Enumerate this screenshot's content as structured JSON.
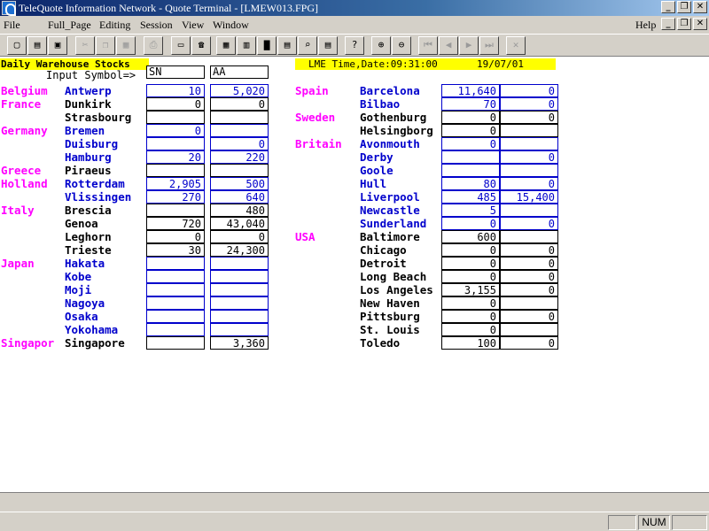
{
  "window": {
    "title": "TeleQuote Information Network - Quote Terminal - [LMEW013.FPG]",
    "buttons": [
      "_",
      "❐",
      "✕"
    ]
  },
  "menu": {
    "items": [
      "File",
      "Full_Page",
      "Editing",
      "Session",
      "View",
      "Window"
    ],
    "help": "Help",
    "mdi_buttons": [
      "_",
      "❐",
      "✕"
    ]
  },
  "toolbar": {
    "buttons": [
      "new-icon",
      "open-icon",
      "save-icon",
      "cut-icon",
      "copy-icon",
      "paste-icon",
      "print-icon",
      "keypad-icon",
      "phone-icon",
      "grid-icon",
      "chart-icon",
      "bar-chart-icon",
      "live-icon",
      "zoom-page-icon",
      "news-icon",
      "help-icon",
      "zoom-in-icon",
      "zoom-out-icon",
      "first-icon",
      "prev-icon",
      "next-icon",
      "last-icon",
      "close-icon"
    ]
  },
  "page": {
    "title": "Daily Warehouse Stocks",
    "input_label": "Input Symbol=>",
    "symbol1": "SN",
    "symbol2": "AA",
    "time_label": "LME Time,Date:09:31:00",
    "date": "19/07/01",
    "left_rows": [
      {
        "country": "Belgium",
        "city": "Antwerp",
        "blue": true,
        "v1": "10",
        "v2": "5,020"
      },
      {
        "country": "France",
        "city": "Dunkirk",
        "blue": false,
        "v1": "0",
        "v2": "0"
      },
      {
        "country": "",
        "city": "Strasbourg",
        "blue": false,
        "v1": "",
        "v2": ""
      },
      {
        "country": "Germany",
        "city": "Bremen",
        "blue": true,
        "v1": "0",
        "v2": ""
      },
      {
        "country": "",
        "city": "Duisburg",
        "blue": true,
        "v1": "",
        "v2": "0"
      },
      {
        "country": "",
        "city": "Hamburg",
        "blue": true,
        "v1": "20",
        "v2": "220"
      },
      {
        "country": "Greece",
        "city": "Piraeus",
        "blue": false,
        "v1": "",
        "v2": ""
      },
      {
        "country": "Holland",
        "city": "Rotterdam",
        "blue": true,
        "v1": "2,905",
        "v2": "500"
      },
      {
        "country": "",
        "city": "Vlissingen",
        "blue": true,
        "v1": "270",
        "v2": "640"
      },
      {
        "country": "Italy",
        "city": "Brescia",
        "blue": false,
        "v1": "",
        "v2": "480"
      },
      {
        "country": "",
        "city": "Genoa",
        "blue": false,
        "v1": "720",
        "v2": "43,040"
      },
      {
        "country": "",
        "city": "Leghorn",
        "blue": false,
        "v1": "0",
        "v2": "0"
      },
      {
        "country": "",
        "city": "Trieste",
        "blue": false,
        "v1": "30",
        "v2": "24,300"
      },
      {
        "country": "Japan",
        "city": "Hakata",
        "blue": true,
        "v1": "",
        "v2": ""
      },
      {
        "country": "",
        "city": "Kobe",
        "blue": true,
        "v1": "",
        "v2": ""
      },
      {
        "country": "",
        "city": "Moji",
        "blue": true,
        "v1": "",
        "v2": ""
      },
      {
        "country": "",
        "city": "Nagoya",
        "blue": true,
        "v1": "",
        "v2": ""
      },
      {
        "country": "",
        "city": "Osaka",
        "blue": true,
        "v1": "",
        "v2": ""
      },
      {
        "country": "",
        "city": "Yokohama",
        "blue": true,
        "v1": "",
        "v2": ""
      },
      {
        "country": "Singapor",
        "city": "Singapore",
        "blue": false,
        "v1": "",
        "v2": "3,360"
      }
    ],
    "right_rows": [
      {
        "country": "Spain",
        "city": "Barcelona",
        "blue": true,
        "v1": "11,640",
        "v2": "0"
      },
      {
        "country": "",
        "city": "Bilbao",
        "blue": true,
        "v1": "70",
        "v2": "0"
      },
      {
        "country": "Sweden",
        "city": "Gothenburg",
        "blue": false,
        "v1": "0",
        "v2": "0"
      },
      {
        "country": "",
        "city": "Helsingborg",
        "blue": false,
        "v1": "0",
        "v2": ""
      },
      {
        "country": "Britain",
        "city": "Avonmouth",
        "blue": true,
        "v1": "0",
        "v2": ""
      },
      {
        "country": "",
        "city": "Derby",
        "blue": true,
        "v1": "",
        "v2": "0"
      },
      {
        "country": "",
        "city": "Goole",
        "blue": true,
        "v1": "",
        "v2": ""
      },
      {
        "country": "",
        "city": "Hull",
        "blue": true,
        "v1": "80",
        "v2": "0"
      },
      {
        "country": "",
        "city": "Liverpool",
        "blue": true,
        "v1": "485",
        "v2": "15,400"
      },
      {
        "country": "",
        "city": "Newcastle",
        "blue": true,
        "v1": "5",
        "v2": ""
      },
      {
        "country": "",
        "city": "Sunderland",
        "blue": true,
        "v1": "0",
        "v2": "0"
      },
      {
        "country": "USA",
        "city": "Baltimore",
        "blue": false,
        "v1": "600",
        "v2": ""
      },
      {
        "country": "",
        "city": "Chicago",
        "blue": false,
        "v1": "0",
        "v2": "0"
      },
      {
        "country": "",
        "city": "Detroit",
        "blue": false,
        "v1": "0",
        "v2": "0"
      },
      {
        "country": "",
        "city": "Long Beach",
        "blue": false,
        "v1": "0",
        "v2": "0"
      },
      {
        "country": "",
        "city": "Los Angeles",
        "blue": false,
        "v1": "3,155",
        "v2": "0"
      },
      {
        "country": "",
        "city": "New Haven",
        "blue": false,
        "v1": "0",
        "v2": ""
      },
      {
        "country": "",
        "city": "Pittsburg",
        "blue": false,
        "v1": "0",
        "v2": "0"
      },
      {
        "country": "",
        "city": "St. Louis",
        "blue": false,
        "v1": "0",
        "v2": ""
      },
      {
        "country": "",
        "city": "Toledo",
        "blue": false,
        "v1": "100",
        "v2": "0"
      }
    ]
  },
  "status": {
    "num": "NUM"
  },
  "colors": {
    "country": "#ff00ff",
    "city_blue": "#0000cc",
    "header_bg": "#ffff00"
  }
}
